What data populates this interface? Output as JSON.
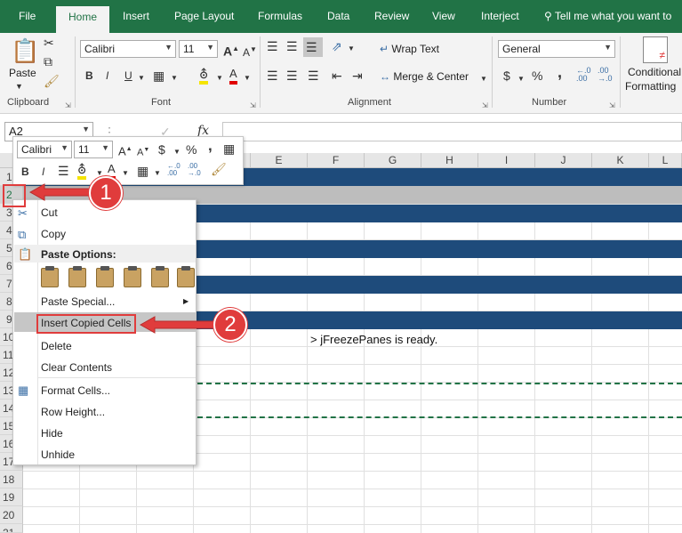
{
  "ribbon": {
    "tabs": [
      "File",
      "Home",
      "Insert",
      "Page Layout",
      "Formulas",
      "Data",
      "Review",
      "View",
      "Interject"
    ],
    "tell_me": "Tell me what you want to",
    "clipboard": {
      "paste": "Paste",
      "label": "Clipboard"
    },
    "font": {
      "name": "Calibri",
      "size": "11",
      "label": "Font"
    },
    "alignment": {
      "wrap_text": "Wrap Text",
      "merge_center": "Merge & Center",
      "label": "Alignment"
    },
    "number": {
      "format": "General",
      "currency": "$",
      "percent": "%",
      "comma": ",",
      "label": "Number"
    },
    "styles": {
      "conditional": "Conditional",
      "formatting": "Formatting"
    }
  },
  "formula_bar": {
    "name_box": "A2",
    "fx": "fx"
  },
  "mini_toolbar": {
    "font": "Calibri",
    "size": "11",
    "bold": "B",
    "italic": "I",
    "currency": "$",
    "percent": "%",
    "comma": ","
  },
  "grid": {
    "columns": [
      "E",
      "F",
      "G",
      "H",
      "I",
      "J",
      "K",
      "L"
    ],
    "rows": [
      "1",
      "2",
      "3",
      "4",
      "5",
      "6",
      "7",
      "8",
      "9",
      "10",
      "11",
      "12",
      "13",
      "14",
      "15",
      "16",
      "17",
      "18",
      "19",
      "20",
      "21"
    ],
    "cell_text": "> jFreezePanes is ready."
  },
  "context_menu": {
    "cut": "Cut",
    "copy": "Copy",
    "paste_options": "Paste Options:",
    "paste_special": "Paste Special...",
    "insert_copied_cells": "Insert Copied Cells",
    "delete": "Delete",
    "clear_contents": "Clear Contents",
    "format_cells": "Format Cells...",
    "row_height": "Row Height...",
    "hide": "Hide",
    "unhide": "Unhide"
  },
  "callouts": {
    "one": "1",
    "two": "2"
  },
  "colors": {
    "excel_green": "#217346",
    "band_blue": "#1e4b7b",
    "callout_red": "#e03c3c"
  }
}
